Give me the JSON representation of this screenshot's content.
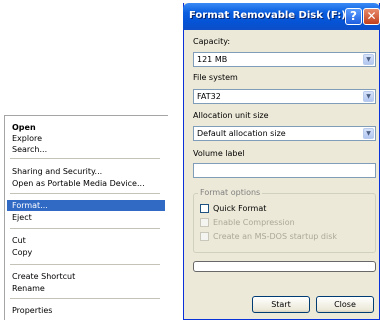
{
  "context_menu": {
    "items": [
      {
        "label": "Open"
      },
      {
        "label": "Explore"
      },
      {
        "label": "Search..."
      },
      {
        "label": "Sharing and Security..."
      },
      {
        "label": "Open as Portable Media Device..."
      },
      {
        "label": "Format..."
      },
      {
        "label": "Eject"
      },
      {
        "label": "Cut"
      },
      {
        "label": "Copy"
      },
      {
        "label": "Create Shortcut"
      },
      {
        "label": "Rename"
      },
      {
        "label": "Properties"
      }
    ]
  },
  "dialog": {
    "title": "Format Removable Disk (F:)",
    "help_glyph": "?",
    "close_glyph": "✕",
    "capacity": {
      "label": "Capacity:",
      "value": "121 MB"
    },
    "file_system": {
      "label": "File system",
      "value": "FAT32"
    },
    "allocation": {
      "label": "Allocation unit size",
      "value": "Default allocation size"
    },
    "volume_label": {
      "label": "Volume label",
      "value": ""
    },
    "format_options": {
      "legend": "Format options",
      "quick_format": "Quick Format",
      "enable_compression": "Enable Compression",
      "ms_dos": "Create an MS-DOS startup disk"
    },
    "progress": 0,
    "start_label": "Start",
    "close_label": "Close"
  },
  "colors": {
    "selection": "#316ac5",
    "titlebar": "#0a5fe0",
    "dialog_bg": "#ece9d8"
  }
}
